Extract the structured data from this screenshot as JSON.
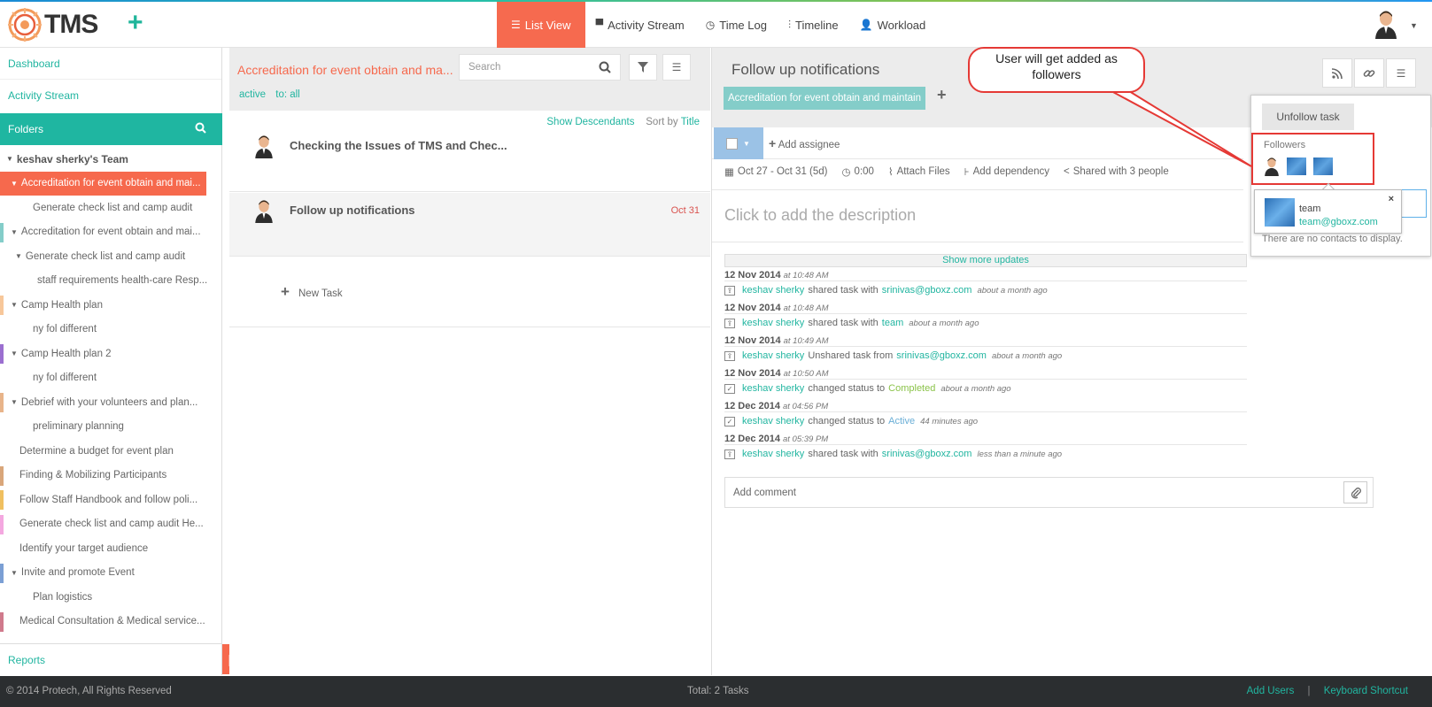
{
  "header": {
    "logo_text": "TMS",
    "nav": [
      {
        "label": "List View",
        "icon": "list-icon",
        "active": true
      },
      {
        "label": "Activity Stream",
        "icon": "comment-icon"
      },
      {
        "label": "Time Log",
        "icon": "clock-icon"
      },
      {
        "label": "Timeline",
        "icon": "sliders-icon"
      },
      {
        "label": "Workload",
        "icon": "user-icon"
      }
    ]
  },
  "sidebar": {
    "dashboard": "Dashboard",
    "activity_stream": "Activity Stream",
    "folders": "Folders",
    "team": "keshav sherky's Team",
    "items": [
      {
        "label": "Accreditation for event obtain and mai...",
        "indent": 1,
        "arrow": true,
        "color": "#f6694d",
        "selected": true
      },
      {
        "label": "Generate check list and camp audit",
        "indent": 3,
        "arrow": false,
        "color": ""
      },
      {
        "label": "Accreditation for event obtain and mai...",
        "indent": 1,
        "arrow": true,
        "color": "#84cdc9"
      },
      {
        "label": "Generate check list and camp audit",
        "indent": 2,
        "arrow": true,
        "color": ""
      },
      {
        "label": "staff requirements health-care Resp...",
        "indent": 4,
        "arrow": false,
        "color": ""
      },
      {
        "label": "Camp Health plan",
        "indent": 1,
        "arrow": true,
        "color": "#f7c79a"
      },
      {
        "label": "ny fol different",
        "indent": 3,
        "arrow": false,
        "color": ""
      },
      {
        "label": "Camp Health plan 2",
        "indent": 1,
        "arrow": true,
        "color": "#9b6fd0"
      },
      {
        "label": "ny fol different",
        "indent": 3,
        "arrow": false,
        "color": ""
      },
      {
        "label": "Debrief with your volunteers and plan...",
        "indent": 1,
        "arrow": true,
        "color": "#e8b48a"
      },
      {
        "label": "preliminary planning",
        "indent": 3,
        "arrow": false,
        "color": ""
      },
      {
        "label": "Determine a budget for event plan",
        "indent": 1,
        "arrow": false,
        "color": ""
      },
      {
        "label": "Finding & Mobilizing Participants",
        "indent": 1,
        "arrow": false,
        "color": "#d9a67a"
      },
      {
        "label": "Follow Staff Handbook and follow poli...",
        "indent": 1,
        "arrow": false,
        "color": "#f0c060"
      },
      {
        "label": "Generate check list and camp audit He...",
        "indent": 1,
        "arrow": false,
        "color": "#f4a8e0"
      },
      {
        "label": "Identify your target audience",
        "indent": 1,
        "arrow": false,
        "color": ""
      },
      {
        "label": "Invite and promote Event",
        "indent": 1,
        "arrow": true,
        "color": "#7b9fd4"
      },
      {
        "label": "Plan logistics",
        "indent": 3,
        "arrow": false,
        "color": ""
      },
      {
        "label": "Medical Consultation & Medical service...",
        "indent": 1,
        "arrow": false,
        "color": "#d07a8c"
      }
    ],
    "reports": "Reports"
  },
  "middle": {
    "title": "Accreditation for event obtain and ma...",
    "search_placeholder": "Search",
    "filter_active": "active",
    "filter_to": "to: all",
    "show_descendants": "Show Descendants",
    "sort_by": "Sort by",
    "sort_field": "Title",
    "tasks": [
      {
        "title": "Checking the Issues of TMS and Chec...",
        "date": ""
      },
      {
        "title": "Follow up notifications",
        "date": "Oct 31"
      }
    ],
    "new_task": "New Task"
  },
  "detail": {
    "title": "Follow up notifications",
    "folder_tag": "Accreditation for event obtain and maintain",
    "add_assignee": "Add assignee",
    "date_range": "Oct 27 - Oct 31 (5d)",
    "time": "0:00",
    "attach": "Attach Files",
    "dependency": "Add dependency",
    "shared": "Shared with 3 people",
    "description_placeholder": "Click to add the description",
    "show_more": "Show more updates",
    "comment_placeholder": "Add comment",
    "log": [
      {
        "date": "12 Nov 2014",
        "time": "at 10:48 AM",
        "user": "keshav sherky",
        "action": "shared task with",
        "target": "srinivas@gboxz.com",
        "kind": "link",
        "ago": "about a month ago"
      },
      {
        "date": "12 Nov 2014",
        "time": "at 10:48 AM",
        "user": "keshav sherky",
        "action": "shared task with",
        "target": "team",
        "kind": "link",
        "ago": "about a month ago"
      },
      {
        "date": "12 Nov 2014",
        "time": "at 10:49 AM",
        "user": "keshav sherky",
        "action": "Unshared task from",
        "target": "srinivas@gboxz.com",
        "kind": "link",
        "ago": "about a month ago"
      },
      {
        "date": "12 Nov 2014",
        "time": "at 10:50 AM",
        "user": "keshav sherky",
        "action": "changed status to",
        "target": "Completed",
        "kind": "completed",
        "ago": "about a month ago"
      },
      {
        "date": "12 Dec 2014",
        "time": "at 04:56 PM",
        "user": "keshav sherky",
        "action": "changed status to",
        "target": "Active",
        "kind": "active",
        "ago": "44 minutes ago"
      },
      {
        "date": "12 Dec 2014",
        "time": "at 05:39 PM",
        "user": "keshav sherky",
        "action": "shared task with",
        "target": "srinivas@gboxz.com",
        "kind": "link",
        "ago": "less than a minute ago"
      }
    ]
  },
  "popover": {
    "unfollow": "Unfollow task",
    "followers_label": "Followers",
    "no_contacts": "There are no contacts to display.",
    "contact_name": "team",
    "contact_email": "team@gboxz.com",
    "close": "×"
  },
  "callout": {
    "text": "User will get added as followers"
  },
  "footer": {
    "copyright": "© 2014 Protech, All Rights Reserved",
    "total": "Total: 2 Tasks",
    "add_users": "Add Users",
    "separator": "|",
    "keyboard": "Keyboard Shortcut"
  },
  "colors": {
    "accent": "#1fb6a1",
    "orange": "#f6694d",
    "annotation": "#e53935"
  }
}
